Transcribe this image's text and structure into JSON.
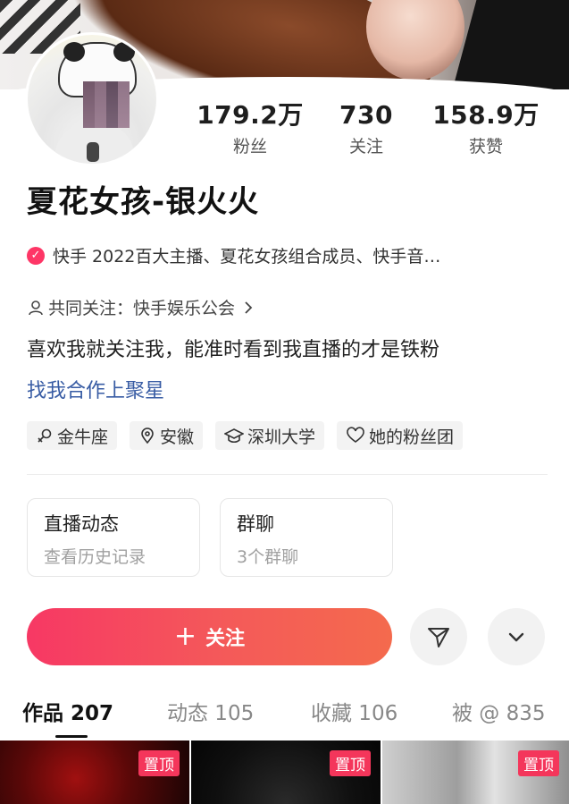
{
  "profile": {
    "nickname": "夏花女孩-银火火",
    "stats": [
      {
        "value": "179.2万",
        "label": "粉丝"
      },
      {
        "value": "730",
        "label": "关注"
      },
      {
        "value": "158.9万",
        "label": "获赞"
      }
    ],
    "verification": "快手 2022百大主播、夏花女孩组合成员、快手音…",
    "mutual_follow": "共同关注：快手娱乐公会",
    "bio": "喜欢我就关注我，能准时看到我直播的才是铁粉",
    "collab_link": "找我合作上聚星",
    "tags": [
      {
        "icon": "gender-female-icon",
        "label": "金牛座"
      },
      {
        "icon": "location-pin-icon",
        "label": "安徽"
      },
      {
        "icon": "graduation-cap-icon",
        "label": "深圳大学"
      },
      {
        "icon": "heart-outline-icon",
        "label": "她的粉丝团"
      }
    ]
  },
  "cards": [
    {
      "title": "直播动态",
      "subtitle": "查看历史记录"
    },
    {
      "title": "群聊",
      "subtitle": "3个群聊"
    }
  ],
  "actions": {
    "follow_label": "关注",
    "follow_plus": "+",
    "share_icon": "send-icon",
    "more_icon": "chevron-down-icon"
  },
  "tabs": [
    {
      "label": "作品 207",
      "active": true
    },
    {
      "label": "动态 105",
      "active": false
    },
    {
      "label": "收藏 106",
      "active": false
    },
    {
      "label": "被 @ 835",
      "active": false
    }
  ],
  "thumbnails": [
    {
      "badge": "置顶"
    },
    {
      "badge": "置顶"
    },
    {
      "badge": "置顶"
    }
  ],
  "colors": {
    "accent": "#fe3666",
    "link": "#385ca4",
    "follow_gradient_start": "#f73864",
    "follow_gradient_end": "#f46a4d"
  }
}
